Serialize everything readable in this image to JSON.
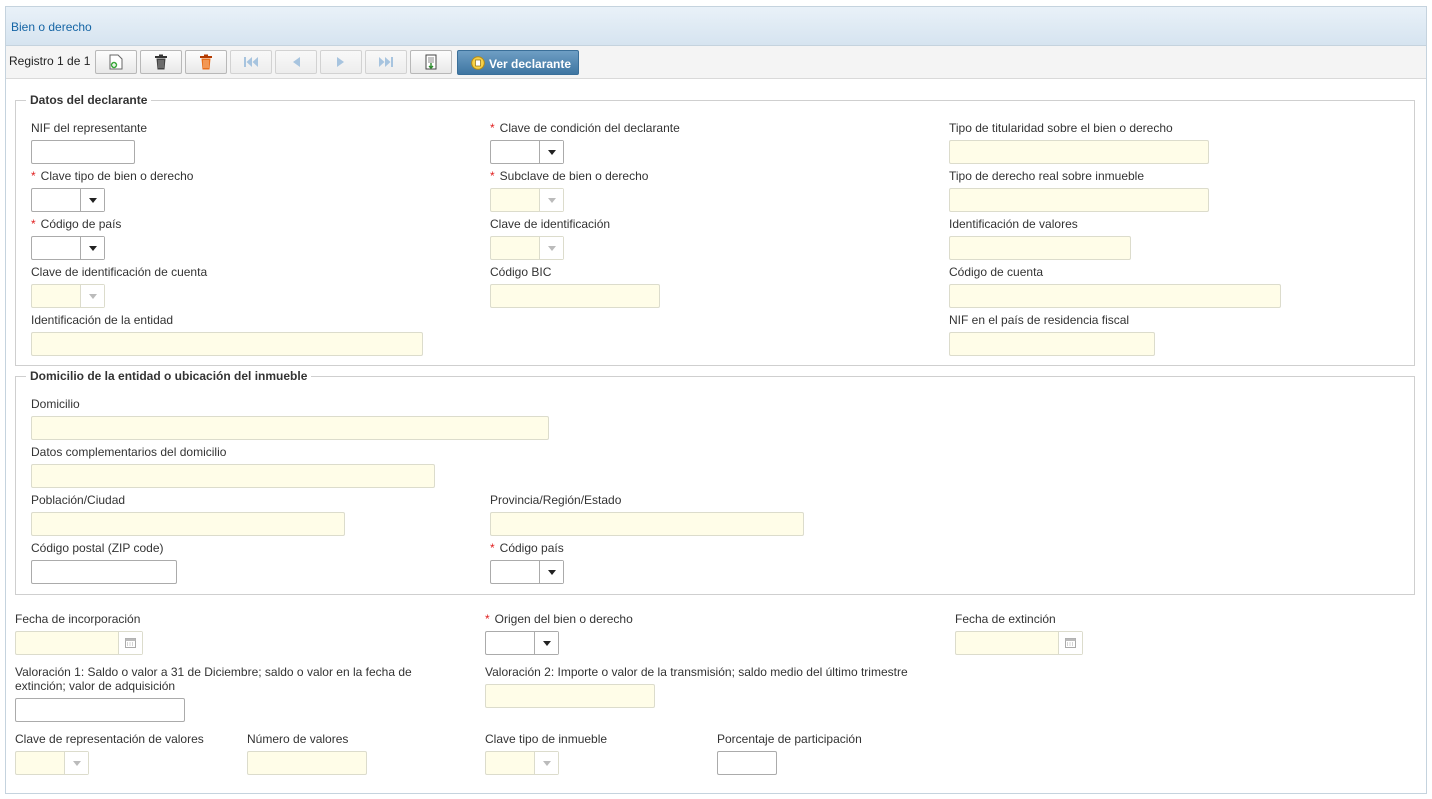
{
  "header": {
    "title": "Bien o derecho"
  },
  "toolbar": {
    "record_label": "Registro 1 de 1",
    "ver_declarante": "Ver declarante",
    "buttons": [
      "new-record-icon",
      "delete-icon",
      "delete-all-icon",
      "first-record-icon",
      "previous-record-icon",
      "next-record-icon",
      "last-record-icon",
      "export-icon"
    ]
  },
  "declarante": {
    "legend": "Datos del declarante",
    "nif_representante": "NIF del representante",
    "clave_condicion": "Clave de condición del declarante",
    "tipo_titularidad": "Tipo de titularidad sobre el bien o derecho",
    "clave_tipo_bien": "Clave tipo de bien o derecho",
    "subclave_bien": "Subclave de bien o derecho",
    "tipo_derecho_real": "Tipo de derecho real sobre inmueble",
    "codigo_pais": "Código de país",
    "clave_identificacion": "Clave de identificación",
    "identificacion_valores": "Identificación de valores",
    "clave_identificacion_cuenta": "Clave de identificación de cuenta",
    "codigo_bic": "Código BIC",
    "codigo_cuenta": "Código de cuenta",
    "identificacion_entidad": "Identificación de la entidad",
    "nif_pais_residencia": "NIF en el país de residencia fiscal"
  },
  "domicilio": {
    "legend": "Domicilio de la entidad o ubicación del inmueble",
    "domicilio": "Domicilio",
    "datos_complementarios": "Datos complementarios del domicilio",
    "poblacion": "Población/Ciudad",
    "provincia": "Provincia/Región/Estado",
    "codigo_postal": "Código postal (ZIP code)",
    "codigo_pais": "Código país"
  },
  "general": {
    "fecha_incorporacion": "Fecha de incorporación",
    "origen_bien": "Origen del bien o derecho",
    "fecha_extincion": "Fecha de extinción",
    "valoracion1": "Valoración 1: Saldo o valor a 31 de Diciembre; saldo o valor en la fecha de extinción; valor de adquisición",
    "valoracion2": "Valoración 2: Importe o valor de la transmisión; saldo medio del último trimestre",
    "clave_representacion": "Clave de representación de valores",
    "numero_valores": "Número de valores",
    "clave_tipo_inmueble": "Clave tipo de inmueble",
    "porcentaje_participacion": "Porcentaje de participación"
  },
  "required_marker": "*",
  "colors": {
    "accent": "#1565a5",
    "readonly_bg": "#fffde8",
    "required": "#e02020",
    "primary_button": "#3f76a2"
  }
}
